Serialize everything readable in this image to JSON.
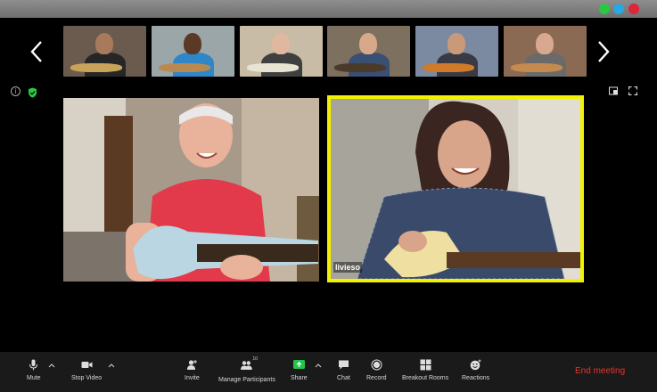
{
  "window": {
    "controls": [
      "close",
      "minimize",
      "zoom"
    ]
  },
  "strip": {
    "thumbnails": [
      {
        "bg": "#6a5b4e",
        "skin": "#a67a5a",
        "shirt": "#262626",
        "guitar": "#c9a35a"
      },
      {
        "bg": "#9aa6a8",
        "skin": "#5a3a26",
        "shirt": "#2f86c8",
        "guitar": "#b88a52"
      },
      {
        "bg": "#c8bca6",
        "skin": "#e0b8a0",
        "shirt": "#3f3f3f",
        "guitar": "#e8e4d4"
      },
      {
        "bg": "#7d705e",
        "skin": "#d8a88a",
        "shirt": "#3a4f74",
        "guitar": "#4a3a2a"
      },
      {
        "bg": "#7b8aa0",
        "skin": "#c89a7a",
        "shirt": "#3a3a44",
        "guitar": "#d07a2a"
      },
      {
        "bg": "#8a6a52",
        "skin": "#d8a890",
        "shirt": "#6a6a6a",
        "guitar": "#c48a50"
      }
    ]
  },
  "main": {
    "right_tile": {
      "name": "livieso",
      "highlight_color": "#f2f200"
    }
  },
  "toolbar": {
    "mute": "Mute",
    "stop_video": "Stop Video",
    "invite": "Invite",
    "manage_participants": "Manage Participants",
    "participant_count": "10",
    "share": "Share",
    "chat": "Chat",
    "record": "Record",
    "breakout_rooms": "Breakout Rooms",
    "reactions": "Reactions",
    "end_meeting": "End meeting",
    "end_color": "#e8312f",
    "share_color": "#23c44a"
  }
}
